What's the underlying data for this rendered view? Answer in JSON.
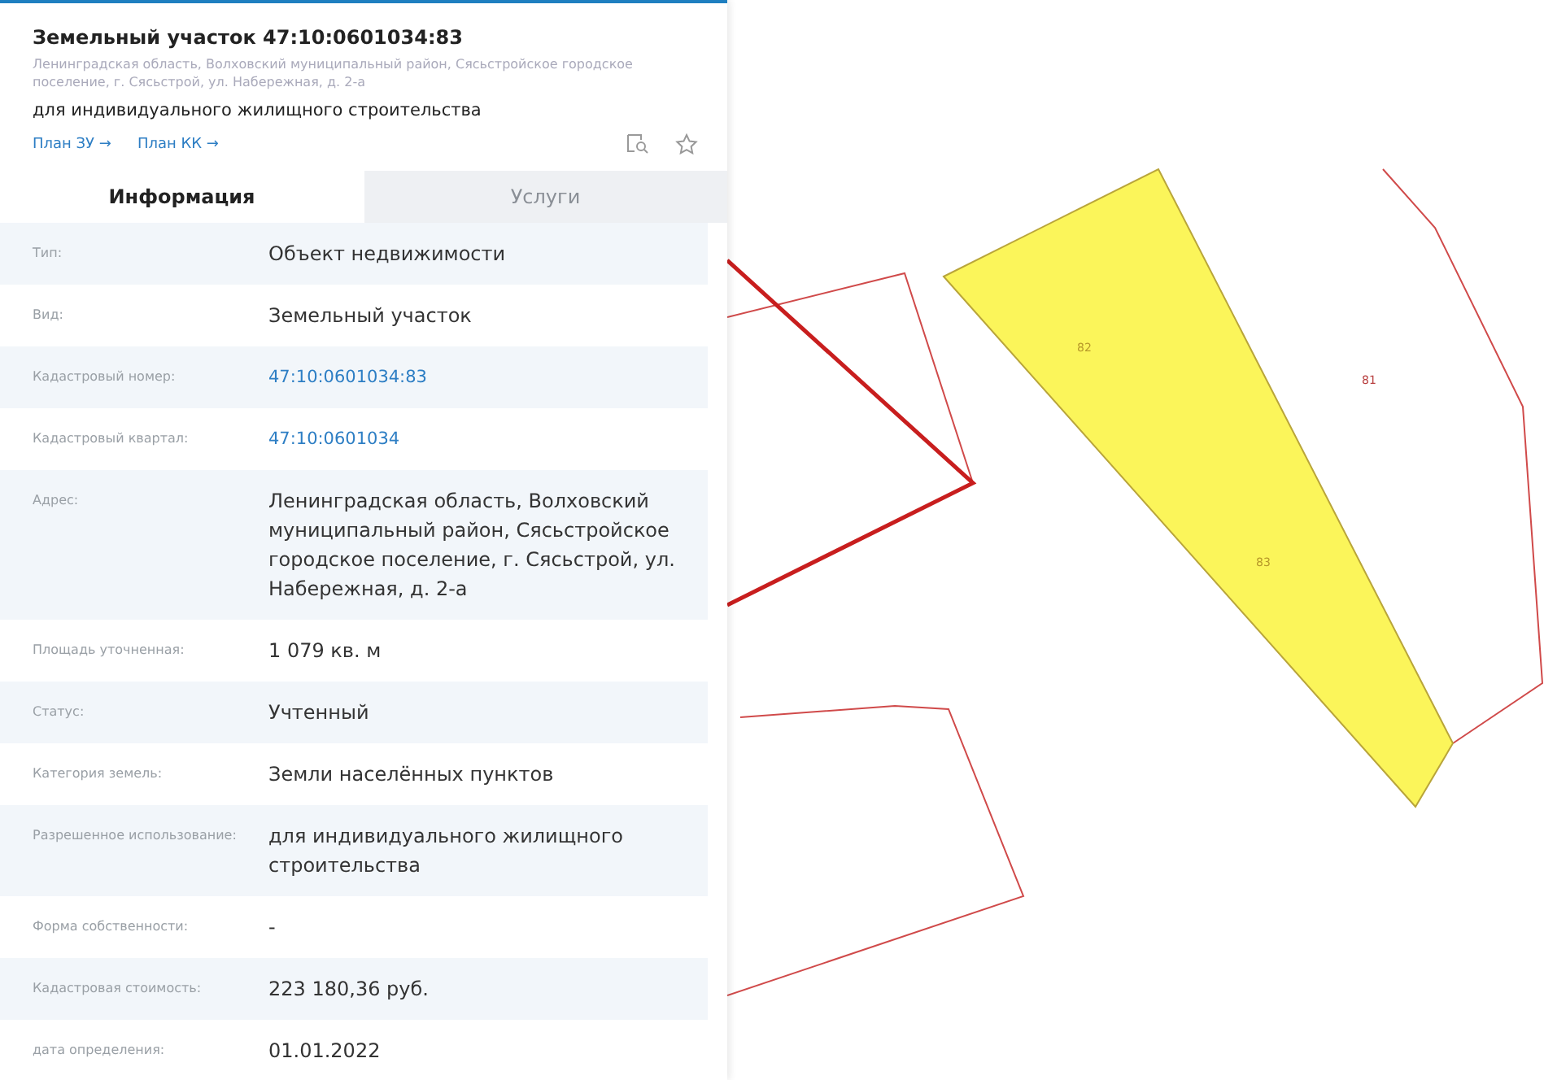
{
  "card": {
    "title": "Земельный участок 47:10:0601034:83",
    "address": "Ленинградская область, Волховский муниципальный район, Сясьстройское городское поселение, г. Сясьстрой, ул. Набережная, д. 2-а",
    "purpose": "для индивидуального жилищного строительства",
    "links": [
      "План ЗУ →",
      "План КК →"
    ]
  },
  "tabs": [
    {
      "label": "Информация",
      "selected": true
    },
    {
      "label": "Услуги",
      "selected": false
    }
  ],
  "rows": [
    {
      "label": "Тип:",
      "value": "Объект недвижимости",
      "kind": "text"
    },
    {
      "label": "Вид:",
      "value": "Земельный участок",
      "kind": "text"
    },
    {
      "label": "Кадастровый номер:",
      "value": "47:10:0601034:83",
      "kind": "link"
    },
    {
      "label": "Кадастровый квартал:",
      "value": "47:10:0601034",
      "kind": "link"
    },
    {
      "label": "Адрес:",
      "value": "Ленинградская область, Волховский муниципальный район, Сясьстройское городское поселение, г. Сясьстрой, ул. Набережная, д. 2-а",
      "kind": "text"
    },
    {
      "label": "Площадь уточненная:",
      "value": "1 079 кв. м",
      "kind": "text"
    },
    {
      "label": "Статус:",
      "value": "Учтенный",
      "kind": "text"
    },
    {
      "label": "Категория земель:",
      "value": "Земли населённых пунктов",
      "kind": "text"
    },
    {
      "label": "Разрешенное использование:",
      "value": "для индивидуального жилищного строительства",
      "kind": "text"
    },
    {
      "label": "Форма собственности:",
      "value": "-",
      "kind": "text"
    },
    {
      "label": "Кадастровая стоимость:",
      "value": "223 180,36 руб.",
      "kind": "text"
    },
    {
      "label": "дата определения:",
      "value": "01.01.2022",
      "kind": "text"
    }
  ],
  "map": {
    "parcels": [
      {
        "label": "82",
        "selected": true
      },
      {
        "label": "83",
        "selected": true
      },
      {
        "label": "81",
        "selected": false
      }
    ]
  }
}
